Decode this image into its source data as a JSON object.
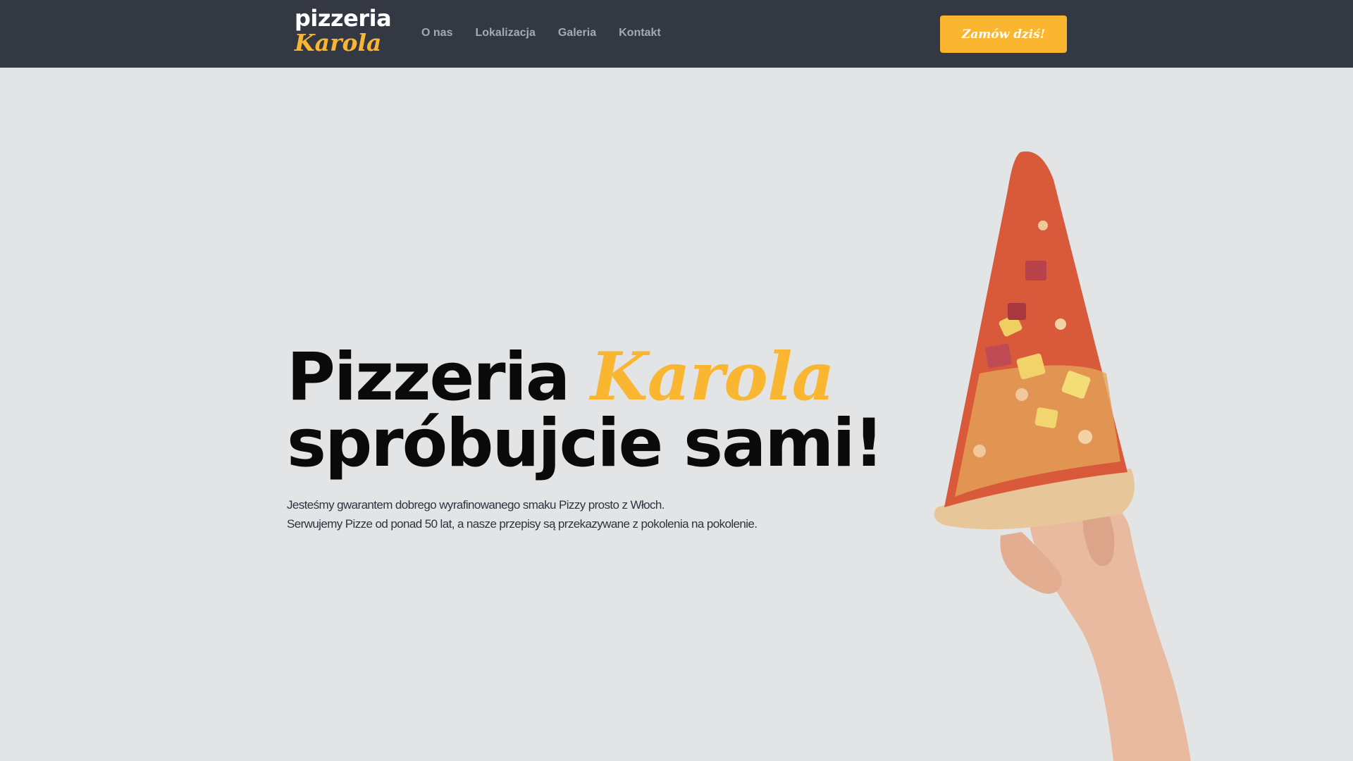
{
  "brand": {
    "logo_top": "pizzeria",
    "logo_bottom": "Karola",
    "accent_color": "#fbb631",
    "nav_bg": "#333843"
  },
  "nav": {
    "items": [
      {
        "label": "O nas"
      },
      {
        "label": "Lokalizacja"
      },
      {
        "label": "Galeria"
      },
      {
        "label": "Kontakt"
      }
    ],
    "cta_label": "Zamów dziś!"
  },
  "hero": {
    "title_word": "Pizzeria",
    "title_accent": "Karola",
    "title_line2": "spróbujcie sami!",
    "description_line1": "Jesteśmy gwarantem dobrego wyrafinowanego smaku Pizzy prosto z Włoch.",
    "description_line2": "Serwujemy Pizze od ponad 50 lat, a nasze przepisy są przekazywane z pokolenia na pokolenie."
  }
}
